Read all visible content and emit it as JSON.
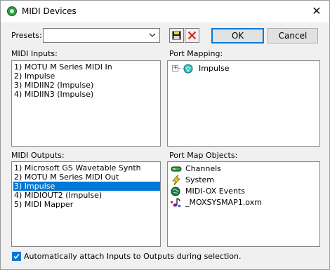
{
  "window": {
    "title": "MIDI Devices",
    "close_glyph": "✕"
  },
  "presets": {
    "label": "Presets:",
    "value": ""
  },
  "buttons": {
    "save_icon": "floppy-disk-icon",
    "delete_icon": "red-x-icon",
    "ok": "OK",
    "cancel": "Cancel"
  },
  "midi_inputs": {
    "label": "MIDI Inputs:",
    "items": [
      "1)  MOTU M Series MIDI In",
      "2)  Impulse",
      "3)  MIDIIN2 (Impulse)",
      "4)  MIDIIN3 (Impulse)"
    ]
  },
  "port_mapping": {
    "label": "Port Mapping:",
    "items": [
      {
        "label": "Impulse",
        "expand": "+",
        "icon": "midi-port-icon"
      }
    ]
  },
  "midi_outputs": {
    "label": "MIDI Outputs:",
    "items": [
      "1)  Microsoft GS Wavetable Synth",
      "2)  MOTU M Series MIDI Out",
      "3)  Impulse",
      "4)  MIDIOUT2 (Impulse)",
      "5)  MIDI Mapper"
    ],
    "selected_index": 2
  },
  "port_map_objects": {
    "label": "Port Map Objects:",
    "items": [
      {
        "label": "Channels",
        "icon": "channels-icon"
      },
      {
        "label": "System",
        "icon": "lightning-icon"
      },
      {
        "label": "MIDI-OX Events",
        "icon": "globe-icon"
      },
      {
        "label": "_MOXSYSMAP1.oxm",
        "icon": "music-note-icon"
      }
    ]
  },
  "auto_attach": {
    "label": "Automatically attach Inputs to Outputs during selection.",
    "checked": true
  },
  "colors": {
    "accent": "#0078d7",
    "window_bg": "#f0f0f0",
    "list_bg": "#ffffff"
  }
}
